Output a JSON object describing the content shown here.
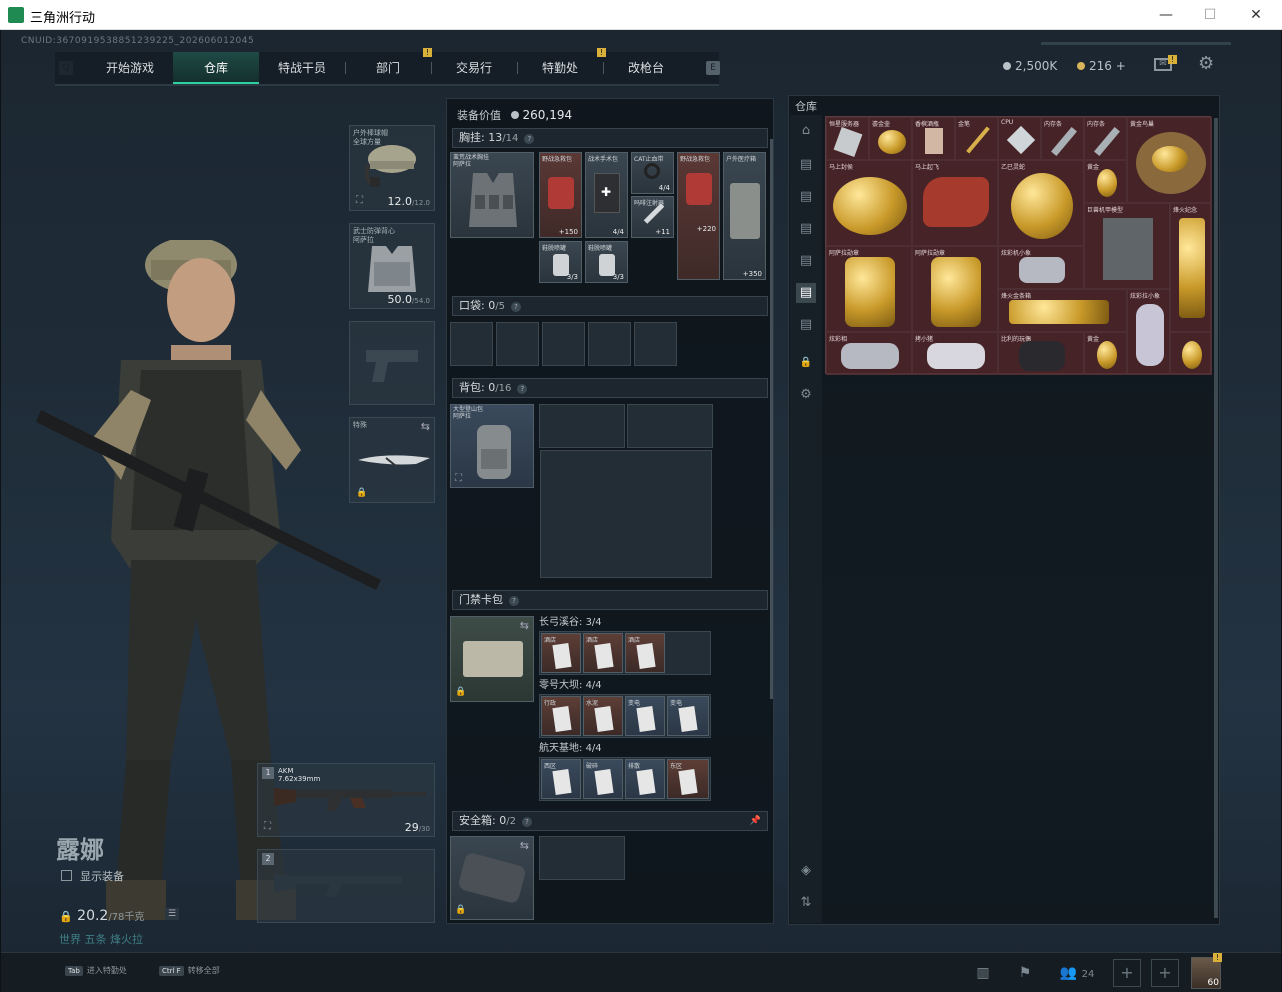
{
  "window": {
    "title": "三角洲行动"
  },
  "header": {
    "cnuid": "CNUID:3670919538851239225_202606012045",
    "tabs": [
      {
        "label": "开始游戏"
      },
      {
        "label": "仓库"
      },
      {
        "label": "特战干员"
      },
      {
        "label": "部门"
      },
      {
        "label": "交易行"
      },
      {
        "label": "特勤处"
      },
      {
        "label": "改枪台"
      }
    ],
    "active_tab": "仓库",
    "badge_mark": "!",
    "currency1": "2,500K",
    "currency2": "216 +",
    "mail_badge": "!"
  },
  "character": {
    "name": "露娜",
    "show_equipment": "显示装备",
    "weight": "20.2",
    "weight_max": "/78千克",
    "tags": "世界  五条  烽火拉"
  },
  "gear": {
    "helmet": {
      "label": "户外棒球帽\n全球方量",
      "value": "12.0",
      "max": "/12.0"
    },
    "armor": {
      "label": "武士防弹背心\n阿萨拉",
      "value": "50.0",
      "max": "/54.0"
    },
    "melee_label": "特殊",
    "weapon1": {
      "num": "1",
      "name": "AKM",
      "caliber": "7.62x39mm",
      "ammo": "29",
      "ammo_max": "/30"
    },
    "weapon2": {
      "num": "2"
    }
  },
  "loadout": {
    "equip_value_label": "装备价值",
    "equip_value": "260,194",
    "chest": {
      "title": "胸挂:",
      "count": "13",
      "max": "/14"
    },
    "chest_rig_label": "蛮荒战术胸挂\n阿萨拉",
    "chest_items": [
      {
        "label": "野战急救包",
        "value": "+150"
      },
      {
        "label": "战术手术包",
        "value": "4/4"
      },
      {
        "label": "CAT止血带",
        "value": "4/4"
      },
      {
        "label": "野战急救包",
        "value": "+220"
      },
      {
        "label": "户外医疗箱",
        "value": "+350"
      },
      {
        "label": "吗啡注射器",
        "value": "+11"
      },
      {
        "label": "鞋脱喷罐",
        "value": "3/3"
      },
      {
        "label": "鞋脱喷罐",
        "value": "3/3"
      }
    ],
    "pocket": {
      "title": "口袋:",
      "count": "0",
      "max": "/5"
    },
    "backpack": {
      "title": "背包:",
      "count": "0",
      "max": "/16"
    },
    "backpack_label": "大型登山包\n阿萨拉",
    "keycard": {
      "title": "门禁卡包"
    },
    "keycard_maps": [
      {
        "name": "长弓溪谷",
        "count": "3/4",
        "cards": [
          "酒店",
          "酒店",
          "酒店"
        ]
      },
      {
        "name": "零号大坝",
        "count": "4/4",
        "cards": [
          "行政",
          "水泥",
          "变电",
          "变电"
        ]
      },
      {
        "name": "航天基地",
        "count": "4/4",
        "cards": [
          "西区",
          "破碎",
          "排散",
          "东区"
        ]
      }
    ],
    "safebox": {
      "title": "安全箱:",
      "count": "0",
      "max": "/2"
    }
  },
  "warehouse": {
    "title": "仓库",
    "items": [
      {
        "label": "恒星服务器"
      },
      {
        "label": "鎏金壶"
      },
      {
        "label": "香槟酒瓶"
      },
      {
        "label": "金笔"
      },
      {
        "label": "CPU"
      },
      {
        "label": "内存条"
      },
      {
        "label": "内存条"
      },
      {
        "label": "黄金鸟巢"
      },
      {
        "label": "马上封侯"
      },
      {
        "label": "马上起飞"
      },
      {
        "label": "乙巳灵蛇"
      },
      {
        "label": "黄金"
      },
      {
        "label": "巨兽机甲模型"
      },
      {
        "label": "烽火纪念"
      },
      {
        "label": "阿萨拉勋章"
      },
      {
        "label": "阿萨拉勋章"
      },
      {
        "label": "炫彩机小象"
      },
      {
        "label": "烽火金条箱"
      },
      {
        "label": "炫彩拉小象"
      },
      {
        "label": "炫彩相"
      },
      {
        "label": "拷小猪"
      },
      {
        "label": "比利的玩偶"
      },
      {
        "label": "黄金"
      }
    ]
  },
  "bottombar": {
    "key1": "Tab",
    "key1_label": "进入特勤处",
    "key2": "Ctrl F",
    "key2_label": "转移全部",
    "friends_count": "24",
    "level": "60"
  },
  "colors": {
    "accent": "#2fd0a0",
    "badge": "#d9b03a",
    "warehouse_bg": "#3a1e22"
  }
}
